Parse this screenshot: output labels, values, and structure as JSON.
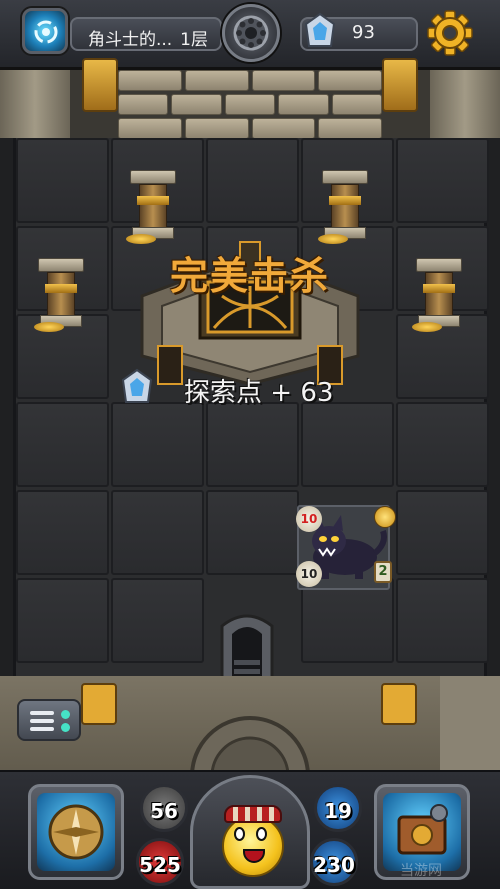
{
  "header": {
    "location_title": "角斗士的...",
    "floor_label": "1层",
    "explore_points": "93",
    "icons": [
      "portal-icon",
      "compass-disc-icon",
      "crystal-icon",
      "gear-icon"
    ]
  },
  "battle_result": {
    "banner": "完美击杀",
    "reward_label": "探索点 + 63"
  },
  "monster": {
    "name_icon": "black-panther-icon",
    "attack": "10",
    "health": "10",
    "level": "2"
  },
  "hud": {
    "attack": "56",
    "health": "525",
    "mana": "19",
    "gold": "230"
  },
  "watermark": "当游网",
  "colors": {
    "banner": "#f1a93a",
    "gold_trim": "#e8b847",
    "health_orb": "#e03a3a",
    "mana_orb": "#3c92e0"
  }
}
